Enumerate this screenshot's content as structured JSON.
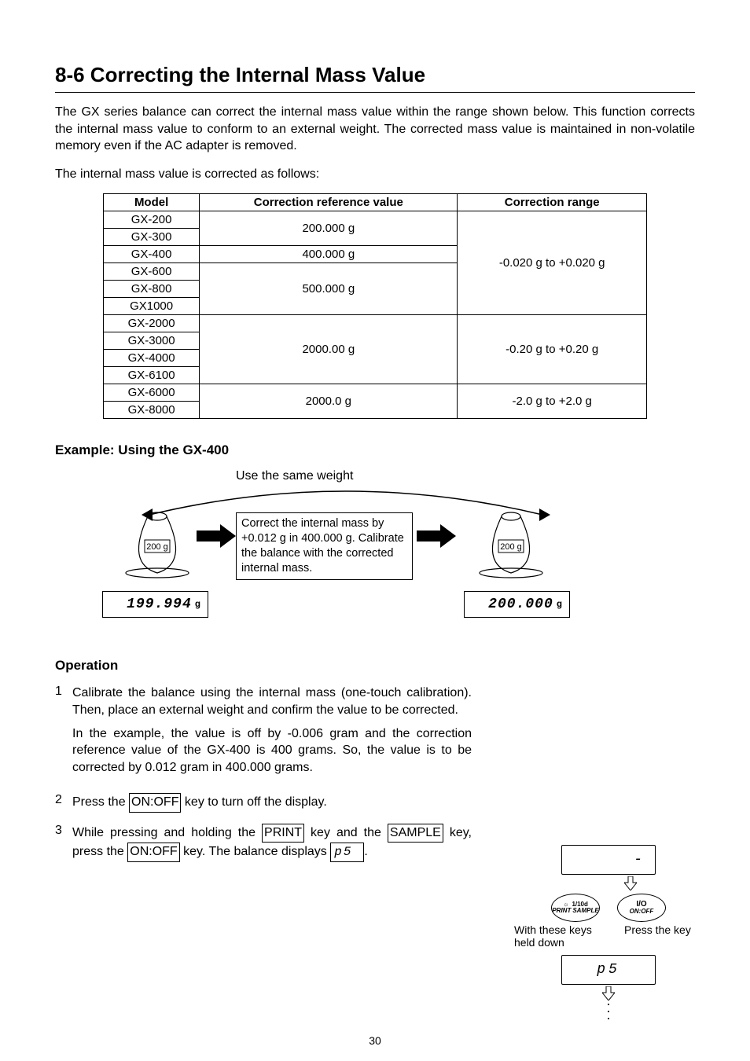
{
  "page_number": "30",
  "section_title": "8-6  Correcting the Internal Mass Value",
  "intro_para": "The GX series balance can correct the internal mass value within the range shown below. This function corrects the internal mass value to conform to an external weight. The corrected mass value is maintained in non-volatile memory even if the AC adapter is removed.",
  "table_intro": "The internal mass value is corrected as follows:",
  "table": {
    "headers": {
      "model": "Model",
      "ref": "Correction reference value",
      "range": "Correction range"
    },
    "groups": [
      {
        "models": [
          "GX-200",
          "GX-300"
        ],
        "ref": "200.000 g",
        "range": "-0.020 g to +0.020 g",
        "range_span": 6
      },
      {
        "models": [
          "GX-400"
        ],
        "ref": "400.000 g"
      },
      {
        "models": [
          "GX-600",
          "GX-800",
          "GX1000"
        ],
        "ref": "500.000 g"
      },
      {
        "models": [
          "GX-2000",
          "GX-3000",
          "GX-4000",
          "GX-6100"
        ],
        "ref": "2000.00 g",
        "range": "-0.20 g to +0.20 g"
      },
      {
        "models": [
          "GX-6000",
          "GX-8000"
        ],
        "ref": "2000.0 g",
        "range": "-2.0 g to +2.0 g"
      }
    ]
  },
  "example_heading": "Example: Using the GX-400",
  "diagram": {
    "caption": "Use the same  weight",
    "weight_label_left": "200 g",
    "weight_label_right": "200 g",
    "display_left": "199.994",
    "display_right": "200.000",
    "unit": "g",
    "instruction": "Correct the internal mass by +0.012 g in 400.000 g. Calibrate the balance with the corrected internal mass."
  },
  "operation": {
    "heading": "Operation",
    "items": [
      {
        "num": "1",
        "para1": "Calibrate the balance using the internal mass (one-touch calibration). Then, place an external weight and confirm the value to be corrected.",
        "para2": "In the example, the value is off by -0.006 gram and the correction reference value of the GX-400 is 400 grams. So, the value is to be corrected by 0.012 gram in 400.000 grams."
      },
      {
        "num": "2",
        "pre": "Press the ",
        "key": "ON:OFF",
        "post": " key to turn off the display."
      },
      {
        "num": "3",
        "parts": {
          "t1": "While pressing and holding the ",
          "k1": "PRINT",
          "t2": " key and the ",
          "k2": "SAMPLE",
          "t3": " key, press the ",
          "k3": "ON:OFF",
          "t4": " key. The balance displays ",
          "disp": "p5",
          "t5": "."
        }
      }
    ]
  },
  "panel": {
    "lcd_top": "-",
    "btn_left_top": "☼",
    "btn_left_bottom_l": "PRINT",
    "btn_left_bottom_r": "1/10d",
    "btn_left_under": "SAMPLE",
    "btn_right_top": "I/O",
    "btn_right_bottom": "ON:OFF",
    "caption_left": "With these keys held down",
    "caption_right": "Press the key",
    "lcd_bottom": "p5"
  }
}
